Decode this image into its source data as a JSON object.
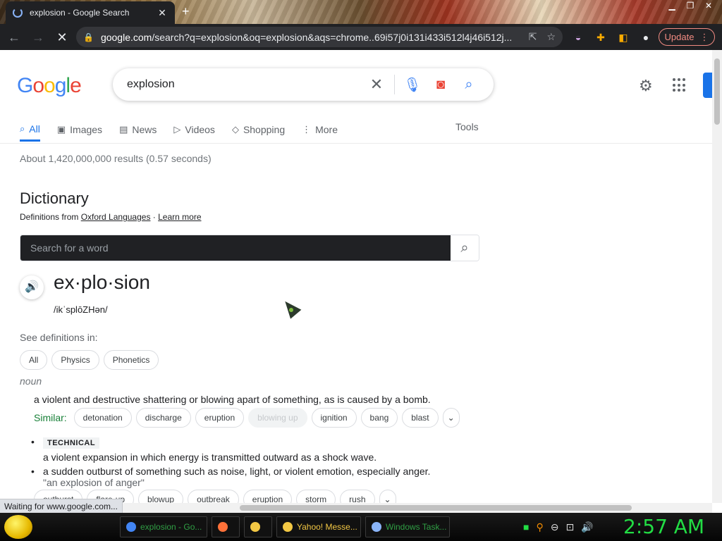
{
  "browser": {
    "tab_title": "explosion - Google Search",
    "tab_close": "✕",
    "new_tab": "+",
    "url_host": "google.com",
    "url_path": "/search?q=explosion&oq=explosion&aqs=chrome..69i57j0i131i433i512l4j46i512j...",
    "update_label": "Update",
    "status_text": "Waiting for www.google.com...",
    "colors": {
      "tab_bg": "#202124",
      "update": "#f28b82"
    }
  },
  "google": {
    "logo_letters": [
      "G",
      "o",
      "o",
      "g",
      "l",
      "e"
    ],
    "logo_colors": [
      "#4285f4",
      "#ea4335",
      "#fbbc05",
      "#4285f4",
      "#34a853",
      "#ea4335"
    ],
    "query": "explosion",
    "tabs": [
      {
        "label": "All",
        "icon": "search-icon",
        "glyph": "⌕"
      },
      {
        "label": "Images",
        "icon": "image-icon",
        "glyph": "▣"
      },
      {
        "label": "News",
        "icon": "news-icon",
        "glyph": "▤"
      },
      {
        "label": "Videos",
        "icon": "video-icon",
        "glyph": "▷"
      },
      {
        "label": "Shopping",
        "icon": "tag-icon",
        "glyph": "◇"
      },
      {
        "label": "More",
        "icon": "more-vert-icon",
        "glyph": "⋮"
      }
    ],
    "tools_label": "Tools",
    "result_stats": "About 1,420,000,000 results (0.57 seconds)"
  },
  "dictionary": {
    "title": "Dictionary",
    "source_prefix": "Definitions from ",
    "source_link": "Oxford Languages",
    "separator": " · ",
    "learn_more": "Learn more",
    "search_placeholder": "Search for a word",
    "headword": "ex·plo·sion",
    "phonetic": "/ikˈsplōZHən/",
    "see_definitions_label": "See definitions in:",
    "definition_chips": [
      "All",
      "Physics",
      "Phonetics"
    ],
    "part_of_speech": "noun",
    "definition_1": "a violent and destructive shattering or blowing apart of something, as is caused by a bomb.",
    "similar_label": "Similar:",
    "similar_1": [
      "detonation",
      "discharge",
      "eruption",
      "blowing up",
      "ignition",
      "bang",
      "blast"
    ],
    "sub_defs": [
      {
        "tag": "TECHNICAL",
        "text": "a violent expansion in which energy is transmitted outward as a shock wave."
      },
      {
        "text": "a sudden outburst of something such as noise, light, or violent emotion, especially anger.",
        "example": "\"an explosion of anger\""
      }
    ],
    "similar_2": [
      "outburst",
      "flare-up",
      "blowup",
      "outbreak",
      "eruption",
      "storm",
      "rush"
    ]
  },
  "taskbar": {
    "tasks": [
      {
        "label": "explosion - Go...",
        "color": "#2f9e44",
        "icon_color": "#4285f4"
      },
      {
        "label": "",
        "color": "#2f9e44",
        "icon_color": "#ff7139"
      },
      {
        "label": "",
        "color": "#2f9e44",
        "icon_color": "#f2c744"
      },
      {
        "label": "Yahoo! Messe...",
        "color": "#f2c744",
        "icon_color": "#f2c744"
      },
      {
        "label": "Windows Task...",
        "color": "#2f9e44",
        "icon_color": "#8ab4f8"
      }
    ],
    "clock": "2:57 AM"
  }
}
